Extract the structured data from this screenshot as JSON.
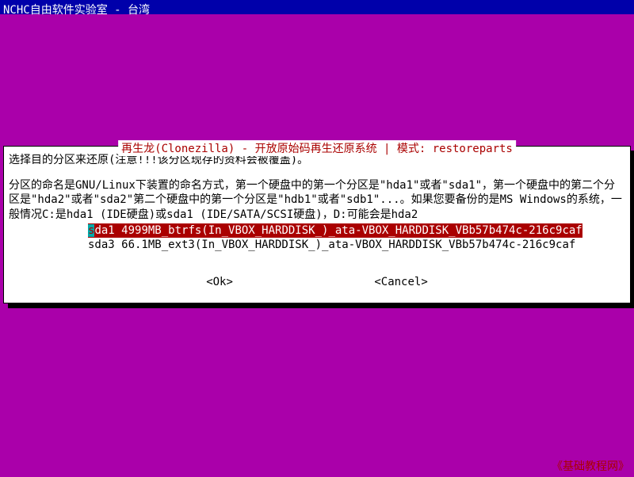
{
  "title_bar": "NCHC自由软件实验室 - 台湾",
  "dialog": {
    "title": "再生龙(Clonezilla) - 开放原始码再生还原系统 | 模式: restoreparts",
    "line1": "选择目的分区来还原(注意!!!该分区现存的资料会被覆盖)。",
    "body": "分区的命名是GNU/Linux下装置的命名方式，第一个硬盘中的第一个分区是\"hda1\"或者\"sda1\"，第一个硬盘中的第二个分区是\"hda2\"或者\"sda2\"第二个硬盘中的第一个分区是\"hdb1\"或者\"sdb1\"...。如果您要备份的是MS Windows的系统，一般情况C:是hda1 (IDE硬盘)或sda1 (IDE/SATA/SCSI硬盘)，D:可能会是hda2"
  },
  "partitions": [
    {
      "hotkey": "s",
      "rest": "da1 4999MB_btrfs(In_VBOX_HARDDISK_)_ata-VBOX_HARDDISK_VBb57b474c-216c9caf",
      "selected": true
    },
    {
      "label": "sda3 66.1MB_ext3(In_VBOX_HARDDISK_)_ata-VBOX_HARDDISK_VBb57b474c-216c9caf",
      "selected": false
    }
  ],
  "buttons": {
    "ok": "<Ok>",
    "cancel": "<Cancel>"
  },
  "watermark": "《基础教程网》"
}
